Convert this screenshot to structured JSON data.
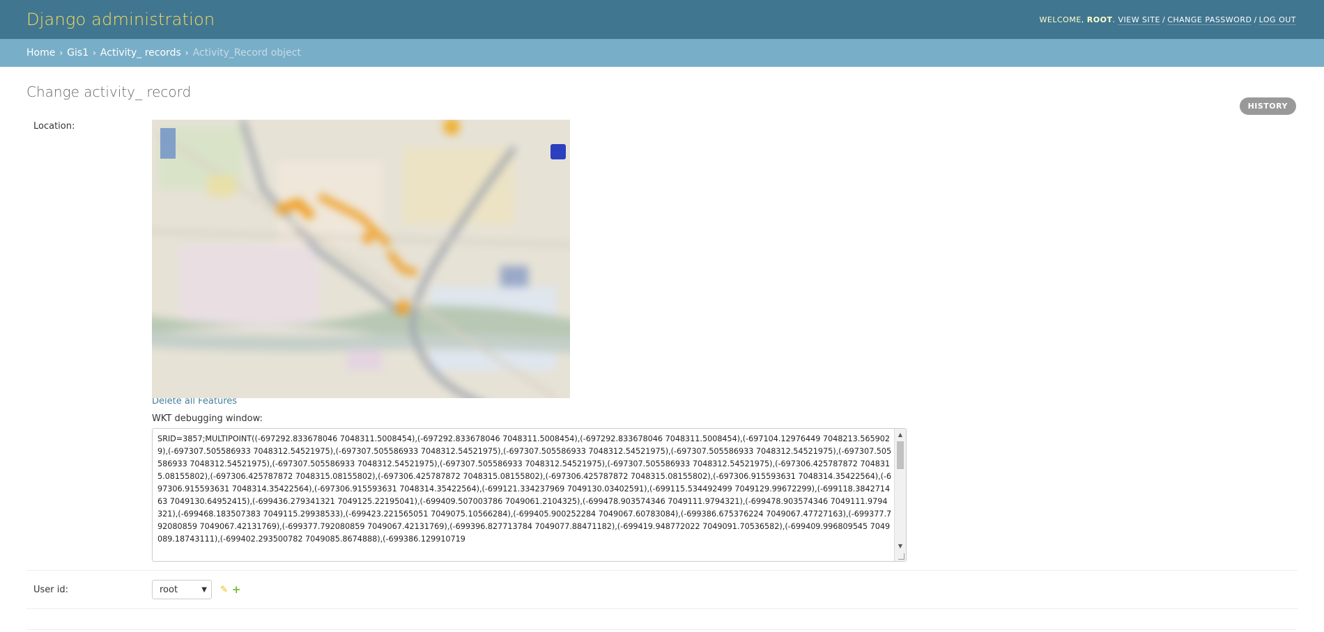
{
  "header": {
    "branding": "Django administration",
    "welcome": "WELCOME, ",
    "username": "ROOT",
    "view_site": "VIEW SITE",
    "change_password": "CHANGE PASSWORD",
    "log_out": "LOG OUT"
  },
  "breadcrumbs": {
    "home": "Home",
    "app": "Gis1",
    "model": "Activity_ records",
    "current": "Activity_Record object"
  },
  "page": {
    "title": "Change activity_ record",
    "history": "HISTORY"
  },
  "location": {
    "label": "Location:",
    "delete_link": "Delete all Features",
    "wkt_label": "WKT debugging window:",
    "wkt_value": "SRID=3857;MULTIPOINT((-697292.833678046 7048311.5008454),(-697292.833678046 7048311.5008454),(-697292.833678046 7048311.5008454),(-697104.12976449 7048213.5659029),(-697307.505586933 7048312.54521975),(-697307.505586933 7048312.54521975),(-697307.505586933 7048312.54521975),(-697307.505586933 7048312.54521975),(-697307.505586933 7048312.54521975),(-697307.505586933 7048312.54521975),(-697307.505586933 7048312.54521975),(-697307.505586933 7048312.54521975),(-697306.425787872 7048315.08155802),(-697306.425787872 7048315.08155802),(-697306.425787872 7048315.08155802),(-697306.425787872 7048315.08155802),(-697306.915593631 7048314.35422564),(-697306.915593631 7048314.35422564),(-697306.915593631 7048314.35422564),(-699121.334237969 7049130.03402591),(-699115.534492499 7049129.99672299),(-699118.384271463 7049130.64952415),(-699436.279341321 7049125.22195041),(-699409.507003786 7049061.2104325),(-699478.903574346 7049111.9794321),(-699478.903574346 7049111.9794321),(-699468.183507383 7049115.29938533),(-699423.221565051 7049075.10566284),(-699405.900252284 7049067.60783084),(-699386.675376224 7049067.47727163),(-699377.792080859 7049067.42131769),(-699377.792080859 7049067.42131769),(-699396.827713784 7049077.88471182),(-699419.948772022 7049091.70536582),(-699409.996809545 7049089.18743111),(-699402.293500782 7049085.8674888),(-699386.129910719"
  },
  "user": {
    "label": "User id:",
    "selected": "root"
  }
}
